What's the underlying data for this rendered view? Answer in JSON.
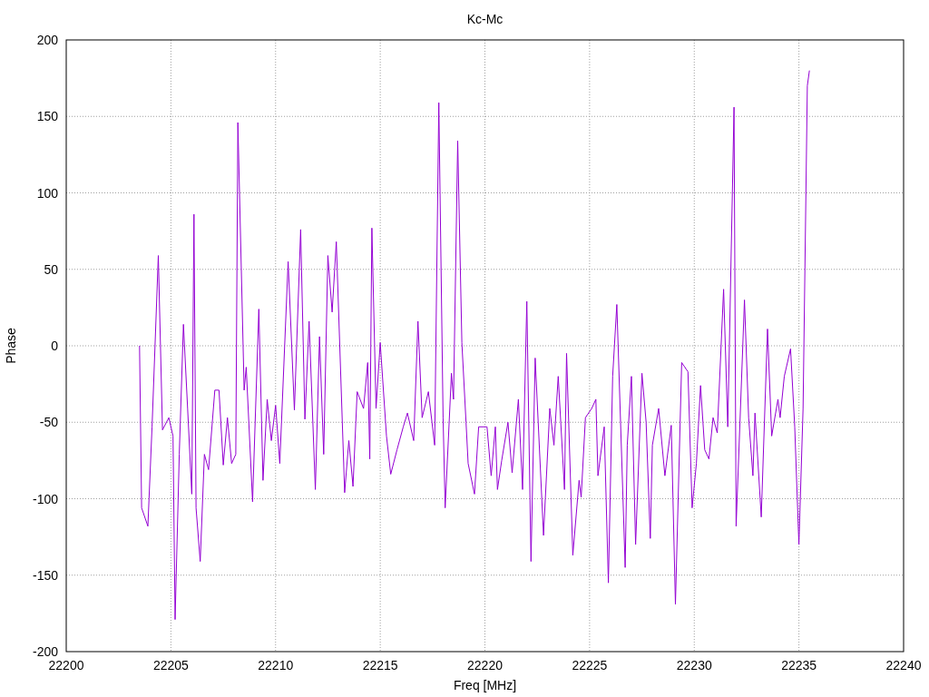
{
  "chart_data": {
    "type": "line",
    "title": "Kc-Mc",
    "xlabel": "Freq [MHz]",
    "ylabel": "Phase",
    "x": [
      22203.5,
      22203.6,
      22203.9,
      22204.1,
      22204.4,
      22204.6,
      22204.9,
      22205.1,
      22205.2,
      22205.4,
      22205.6,
      22205.8,
      22206.0,
      22206.1,
      22206.2,
      22206.4,
      22206.6,
      22206.8,
      22207.1,
      22207.3,
      22207.5,
      22207.7,
      22207.9,
      22208.1,
      22208.2,
      22208.5,
      22208.6,
      22208.9,
      22209.2,
      22209.4,
      22209.6,
      22209.8,
      22210.0,
      22210.2,
      22210.6,
      22210.9,
      22211.2,
      22211.4,
      22211.6,
      22211.9,
      22212.1,
      22212.3,
      22212.5,
      22212.7,
      22212.9,
      22213.3,
      22213.5,
      22213.7,
      22213.9,
      22214.2,
      22214.4,
      22214.5,
      22214.6,
      22214.8,
      22215.0,
      22215.3,
      22215.5,
      22215.8,
      22216.1,
      22216.3,
      22216.6,
      22216.8,
      22217.0,
      22217.3,
      22217.6,
      22217.8,
      22218.0,
      22218.1,
      22218.4,
      22218.5,
      22218.7,
      22218.9,
      22219.1,
      22219.2,
      22219.5,
      22219.7,
      22220.1,
      22220.3,
      22220.5,
      22220.6,
      22220.8,
      22221.1,
      22221.3,
      22221.6,
      22221.8,
      22222.0,
      22222.2,
      22222.4,
      22222.8,
      22223.1,
      22223.3,
      22223.5,
      22223.8,
      22223.9,
      22224.2,
      22224.5,
      22224.6,
      22224.8,
      22225.1,
      22225.3,
      22225.4,
      22225.7,
      22225.9,
      22226.1,
      22226.3,
      22226.7,
      22226.8,
      22227.0,
      22227.2,
      22227.5,
      22227.7,
      22227.9,
      22228.0,
      22228.3,
      22228.6,
      22228.9,
      22229.1,
      22229.4,
      22229.7,
      22229.9,
      22230.1,
      22230.3,
      22230.5,
      22230.7,
      22230.9,
      22231.1,
      22231.4,
      22231.6,
      22231.9,
      22232.0,
      22232.4,
      22232.6,
      22232.8,
      22232.9,
      22233.2,
      22233.5,
      22233.7,
      22234.0,
      22234.1,
      22234.3,
      22234.6,
      22234.8,
      22235.0,
      22235.2,
      22235.4,
      22235.5
    ],
    "grid": true,
    "series": [
      {
        "color": "#9400d3",
        "values": [
          0,
          -106,
          -118,
          -53,
          59,
          -55,
          -47,
          -59,
          -179,
          -71,
          14,
          -41,
          -97,
          86,
          -106,
          -141,
          -71,
          -81,
          -29,
          -29,
          -78,
          -47,
          -77,
          -71,
          146,
          -29,
          -14,
          -102,
          24,
          -88,
          -35,
          -62,
          -39,
          -77,
          55,
          -42,
          76,
          -48,
          16,
          -94,
          6,
          -71,
          59,
          22,
          68,
          -96,
          -62,
          -92,
          -30,
          -41,
          -11,
          -74,
          77,
          -41,
          2,
          -59,
          -84,
          -68,
          -53,
          -44,
          -62,
          16,
          -47,
          -30,
          -65,
          159,
          -47,
          -106,
          -18,
          -35,
          134,
          2,
          -50,
          -77,
          -97,
          -53,
          -53,
          -85,
          -53,
          -94,
          -75,
          -50,
          -83,
          -35,
          -94,
          29,
          -141,
          -8,
          -124,
          -41,
          -65,
          -20,
          -94,
          -5,
          -137,
          -88,
          -99,
          -47,
          -41,
          -35,
          -85,
          -53,
          -155,
          -20,
          27,
          -145,
          -65,
          -20,
          -130,
          -18,
          -50,
          -126,
          -65,
          -41,
          -85,
          -52,
          -169,
          -11,
          -17,
          -106,
          -77,
          -26,
          -68,
          -74,
          -47,
          -57,
          37,
          -53,
          156,
          -118,
          30,
          -47,
          -85,
          -44,
          -112,
          11,
          -59,
          -35,
          -47,
          -20,
          -2,
          -53,
          -130,
          -41,
          170,
          180
        ]
      }
    ],
    "xlim": [
      22200,
      22240
    ],
    "ylim": [
      -200,
      200
    ],
    "xticks": [
      22200,
      22205,
      22210,
      22215,
      22220,
      22225,
      22230,
      22235,
      22240
    ],
    "yticks": [
      -200,
      -150,
      -100,
      -50,
      0,
      50,
      100,
      150,
      200
    ]
  }
}
